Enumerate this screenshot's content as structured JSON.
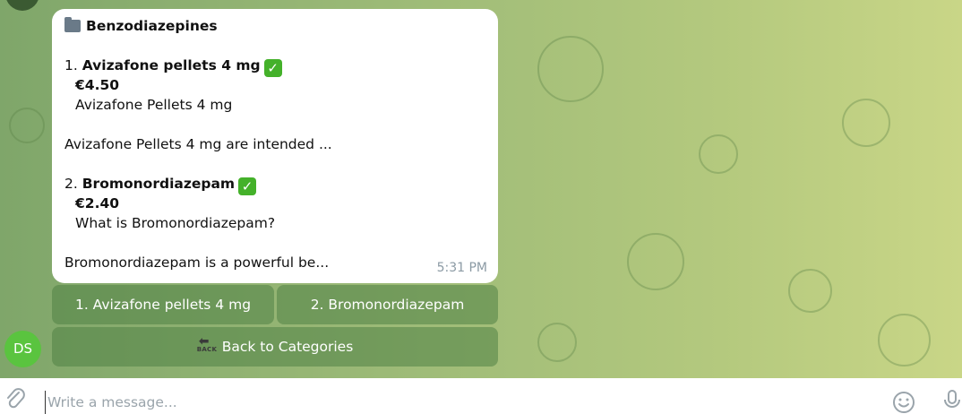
{
  "message": {
    "header_icon": "folder-icon",
    "category": "Benzodiazepines",
    "items": [
      {
        "number": "1.",
        "name": "Avizafone pellets 4 mg",
        "status_icon": "check-mark-icon",
        "price": "€4.50",
        "subtitle": "Avizafone Pellets 4 mg",
        "description": "Avizafone Pellets 4 mg are intended ..."
      },
      {
        "number": "2.",
        "name": "Bromonordiazepam",
        "status_icon": "check-mark-icon",
        "price": "€2.40",
        "subtitle": "What is Bromonordiazepam?",
        "description": "Bromonordiazepam is a powerful be..."
      }
    ],
    "time": "5:31 PM"
  },
  "keyboard": {
    "buttons": [
      "1. Avizafone pellets 4 mg",
      "2. Bromonordiazepam"
    ],
    "back_label": "Back to Categories",
    "back_icon_text": "BACK"
  },
  "user_avatar": {
    "initials": "DS",
    "color": "#5ac43f"
  },
  "composer": {
    "placeholder": "Write a message..."
  },
  "colors": {
    "check": "#44b12a",
    "bubble": "#ffffff",
    "time": "#8b9aa4"
  }
}
